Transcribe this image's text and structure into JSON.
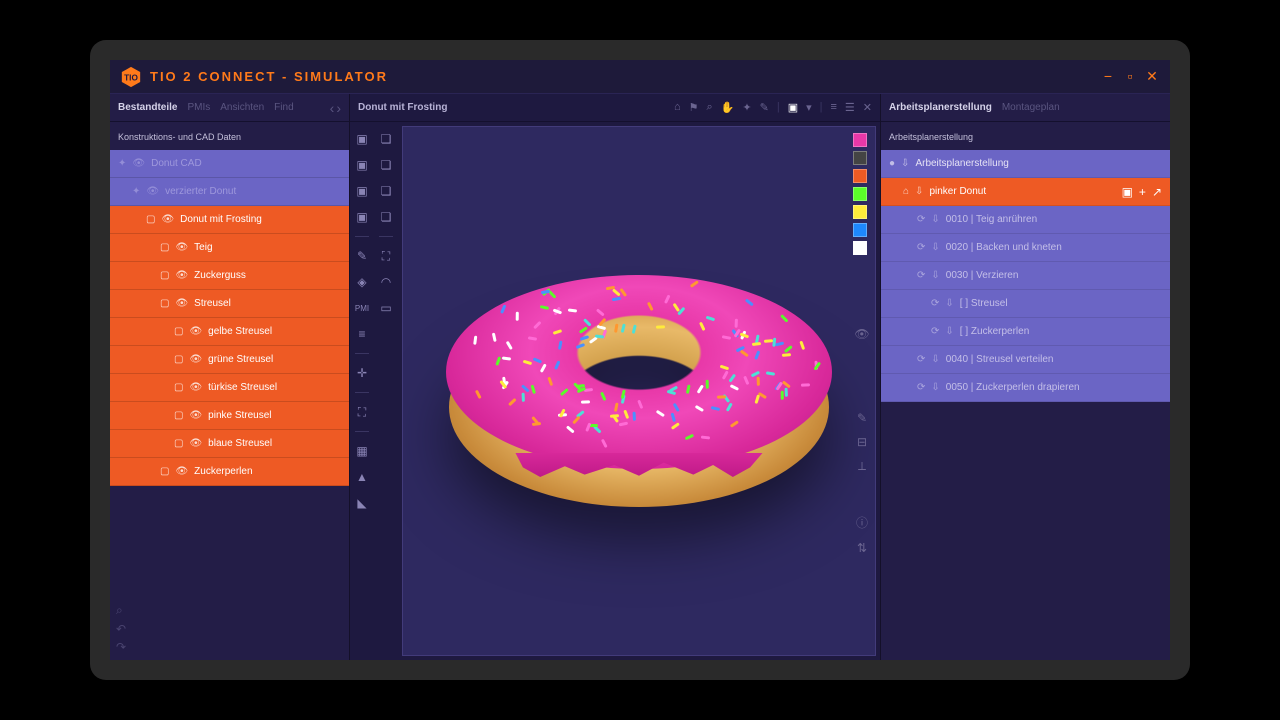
{
  "app": {
    "title": "TIO 2 CONNECT - SIMULATOR"
  },
  "left": {
    "tabs": [
      "Bestandteile",
      "PMIs",
      "Ansichten",
      "Find"
    ],
    "active_tab": "Bestandteile",
    "section": "Konstruktions- und CAD Daten",
    "tree": [
      {
        "label": "Donut CAD",
        "depth": 0,
        "dim": true
      },
      {
        "label": "verzierter Donut",
        "depth": 1,
        "dim": true
      },
      {
        "label": "Donut mit Frosting",
        "depth": 2,
        "dim": false
      },
      {
        "label": "Teig",
        "depth": 3,
        "dim": false
      },
      {
        "label": "Zuckerguss",
        "depth": 3,
        "dim": false
      },
      {
        "label": "Streusel",
        "depth": 3,
        "dim": false
      },
      {
        "label": "gelbe Streusel",
        "depth": 4,
        "dim": false
      },
      {
        "label": "grüne Streusel",
        "depth": 4,
        "dim": false
      },
      {
        "label": "türkise Streusel",
        "depth": 4,
        "dim": false
      },
      {
        "label": "pinke Streusel",
        "depth": 4,
        "dim": false
      },
      {
        "label": "blaue Streusel",
        "depth": 4,
        "dim": false
      },
      {
        "label": "Zuckerperlen",
        "depth": 3,
        "dim": false
      }
    ]
  },
  "center": {
    "title": "Donut mit Frosting",
    "swatches": [
      "#e838a8",
      "#444444",
      "#ee5a24",
      "#5bfc2a",
      "#ffeb3b",
      "#1e88ff",
      "#ffffff"
    ]
  },
  "right": {
    "tabs": [
      "Arbeitsplanerstellung",
      "Montageplan"
    ],
    "active_tab": "Arbeitsplanerstellung",
    "section": "Arbeitsplanerstellung",
    "tree": [
      {
        "label": "Arbeitsplanerstellung",
        "depth": 0,
        "type": "hdr"
      },
      {
        "label": "pinker Donut",
        "depth": 1,
        "type": "orange"
      },
      {
        "label": "0010 | Teig anrühren",
        "depth": 2,
        "type": "blue"
      },
      {
        "label": "0020 | Backen und kneten",
        "depth": 2,
        "type": "blue"
      },
      {
        "label": "0030 | Verzieren",
        "depth": 2,
        "type": "blue"
      },
      {
        "label": "[ ] Streusel",
        "depth": 3,
        "type": "blue"
      },
      {
        "label": "[ ] Zuckerperlen",
        "depth": 3,
        "type": "blue"
      },
      {
        "label": "0040 | Streusel verteilen",
        "depth": 2,
        "type": "blue"
      },
      {
        "label": "0050 | Zuckerperlen drapieren",
        "depth": 2,
        "type": "blue"
      }
    ]
  }
}
